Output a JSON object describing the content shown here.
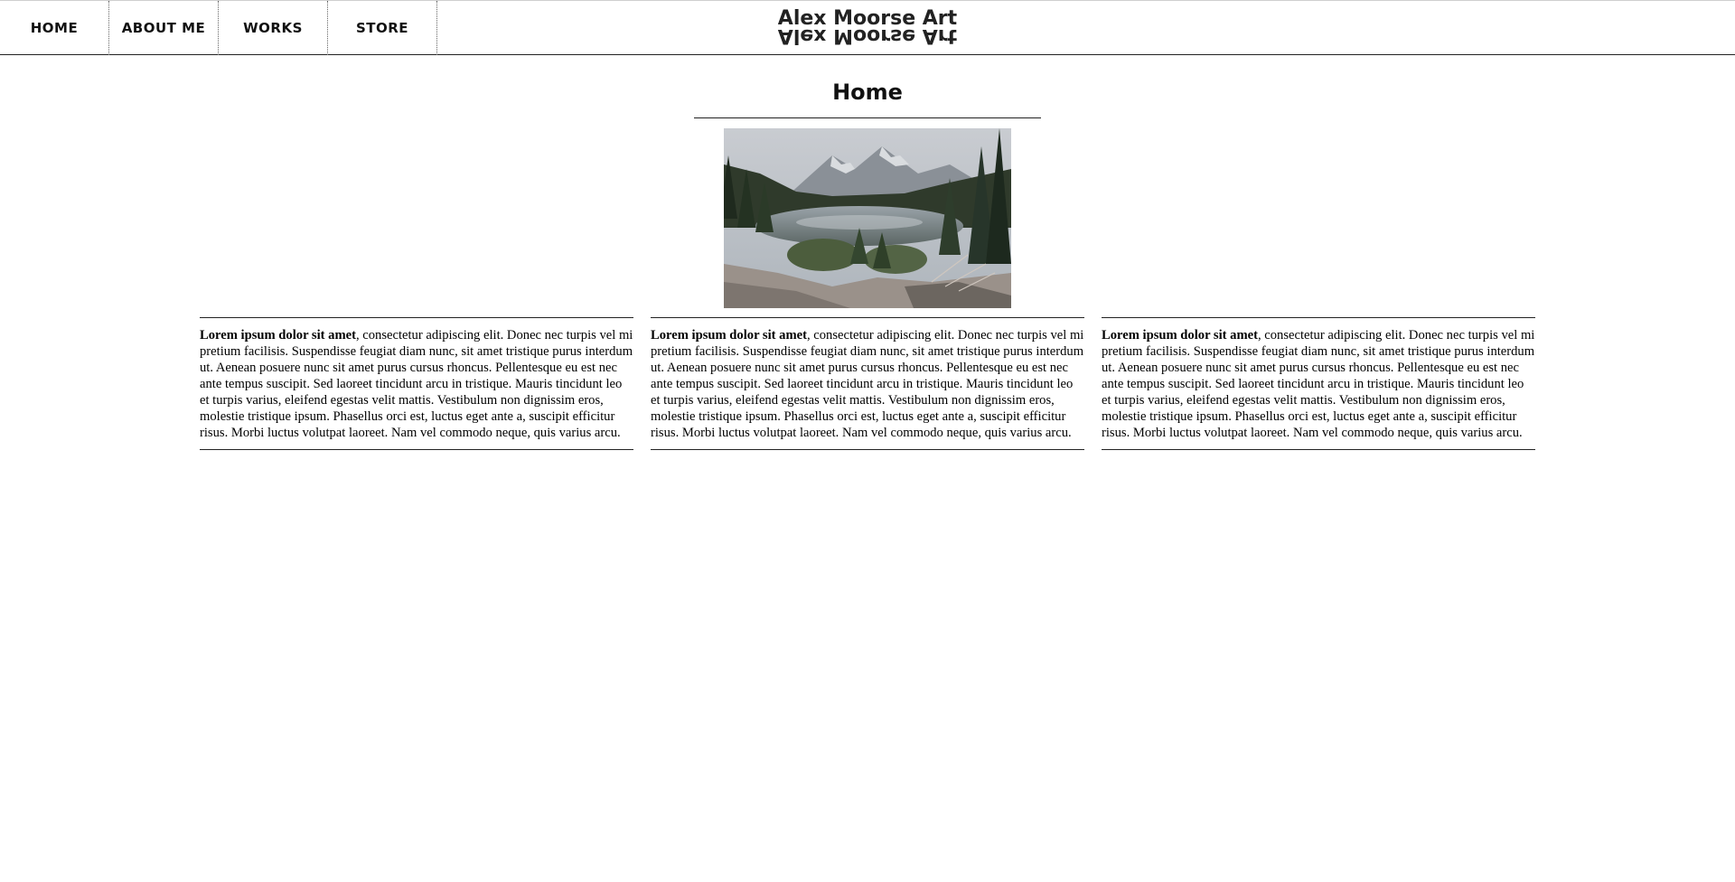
{
  "header": {
    "nav": [
      {
        "label": "HOME"
      },
      {
        "label": "ABOUT ME"
      },
      {
        "label": "WORKS"
      },
      {
        "label": "STORE"
      }
    ],
    "brand": "Alex Moorse Art"
  },
  "main": {
    "title": "Home",
    "hero_image": "mountain-lake-photo",
    "columns": [
      {
        "lead": "Lorem ipsum dolor sit amet",
        "body": ", consectetur adipiscing elit. Donec nec turpis vel mi pretium facilisis. Suspendisse feugiat diam nunc, sit amet tristique purus interdum ut. Aenean posuere nunc sit amet purus cursus rhoncus. Pellentesque eu est nec ante tempus suscipit. Sed laoreet tincidunt arcu in tristique. Mauris tincidunt leo et turpis varius, eleifend egestas velit mattis. Vestibulum non dignissim eros, molestie tristique ipsum. Phasellus orci est, luctus eget ante a, suscipit efficitur risus. Morbi luctus volutpat laoreet. Nam vel commodo neque, quis varius arcu."
      },
      {
        "lead": "Lorem ipsum dolor sit amet",
        "body": ", consectetur adipiscing elit. Donec nec turpis vel mi pretium facilisis. Suspendisse feugiat diam nunc, sit amet tristique purus interdum ut. Aenean posuere nunc sit amet purus cursus rhoncus. Pellentesque eu est nec ante tempus suscipit. Sed laoreet tincidunt arcu in tristique. Mauris tincidunt leo et turpis varius, eleifend egestas velit mattis. Vestibulum non dignissim eros, molestie tristique ipsum. Phasellus orci est, luctus eget ante a, suscipit efficitur risus. Morbi luctus volutpat laoreet. Nam vel commodo neque, quis varius arcu."
      },
      {
        "lead": "Lorem ipsum dolor sit amet",
        "body": ", consectetur adipiscing elit. Donec nec turpis vel mi pretium facilisis. Suspendisse feugiat diam nunc, sit amet tristique purus interdum ut. Aenean posuere nunc sit amet purus cursus rhoncus. Pellentesque eu est nec ante tempus suscipit. Sed laoreet tincidunt arcu in tristique. Mauris tincidunt leo et turpis varius, eleifend egestas velit mattis. Vestibulum non dignissim eros, molestie tristique ipsum. Phasellus orci est, luctus eget ante a, suscipit efficitur risus. Morbi luctus volutpat laoreet. Nam vel commodo neque, quis varius arcu."
      }
    ]
  }
}
